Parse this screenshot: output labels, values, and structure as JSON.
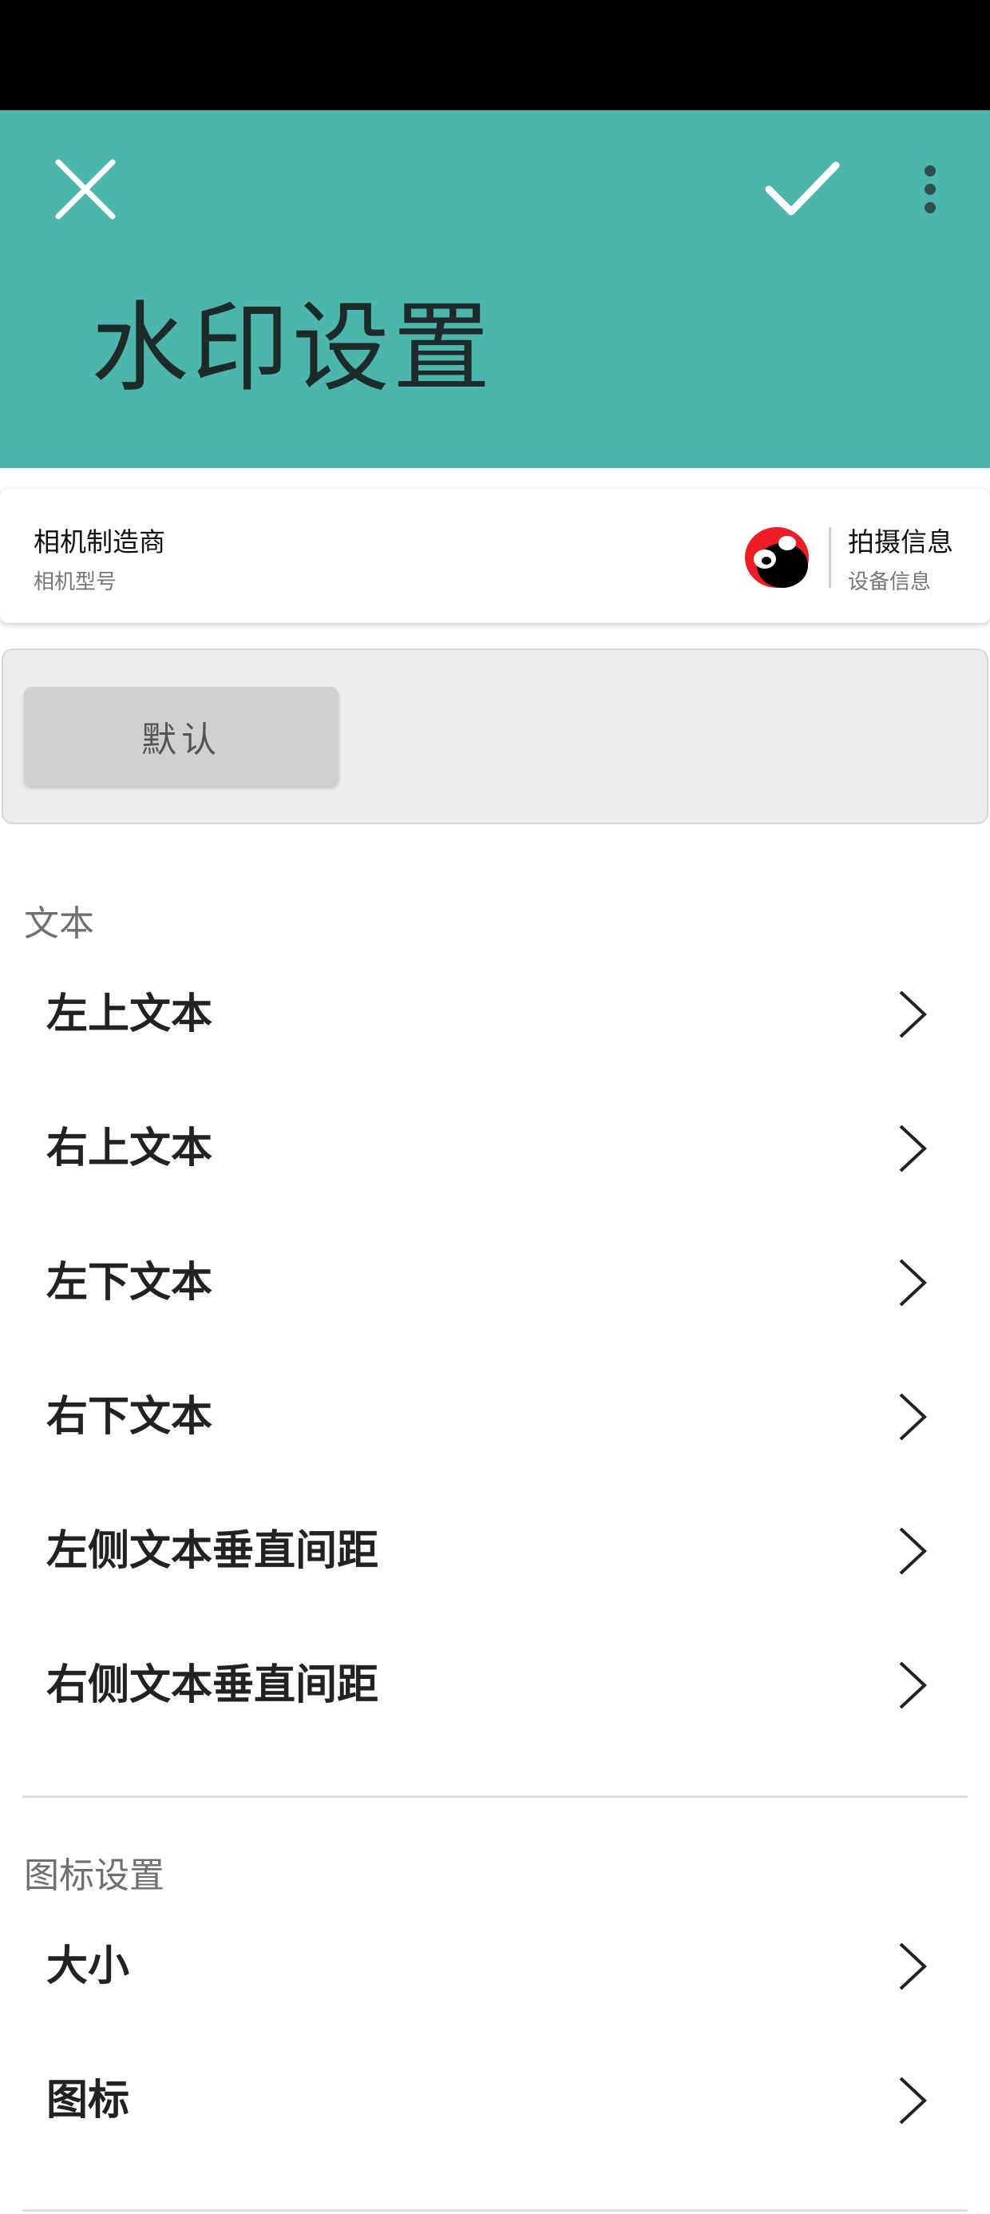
{
  "app_bar": {
    "title": "水印设置",
    "background": "#4db6ac",
    "close_icon": "close-icon",
    "confirm_icon": "check-icon",
    "overflow_icon": "more-vertical-icon"
  },
  "preview": {
    "camera_make": "相机制造商",
    "camera_model": "相机型号",
    "logo_icon": "brand-logo",
    "shot_info": "拍摄信息",
    "device_info": "设备信息"
  },
  "presets": {
    "default_label": "默认"
  },
  "text_section": {
    "header": "文本",
    "items": [
      {
        "label": "左上文本"
      },
      {
        "label": "右上文本"
      },
      {
        "label": "左下文本"
      },
      {
        "label": "右下文本"
      },
      {
        "label": "左侧文本垂直间距"
      },
      {
        "label": "右侧文本垂直间距"
      }
    ]
  },
  "icon_section": {
    "header": "图标设置",
    "items": [
      {
        "label": "大小"
      },
      {
        "label": "图标"
      }
    ]
  }
}
